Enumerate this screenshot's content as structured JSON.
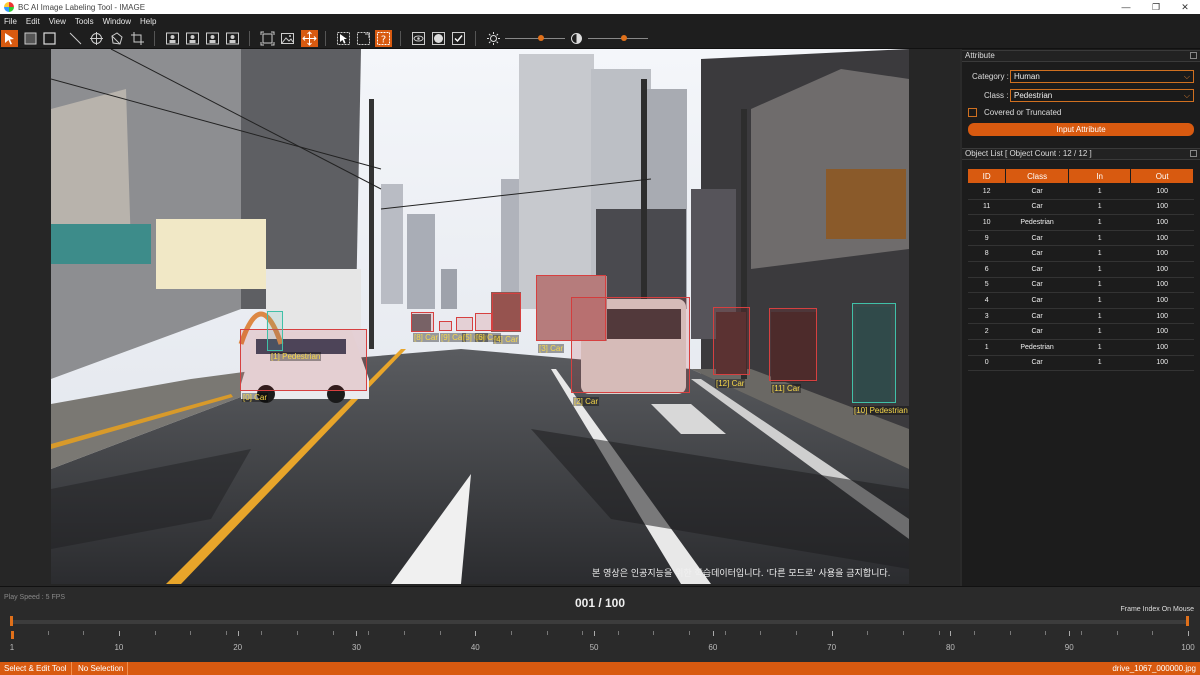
{
  "window": {
    "title": "BC AI Image Labeling Tool - IMAGE",
    "controls": {
      "minimize": "—",
      "restore": "❐",
      "close": "✕"
    }
  },
  "menu": [
    "File",
    "Edit",
    "View",
    "Tools",
    "Window",
    "Help"
  ],
  "toolbar": {
    "icons": [
      "select-arrow-icon",
      "rectangle-icon",
      "square-icon",
      "line-icon",
      "crosshair-icon",
      "polygon-icon",
      "crop-icon",
      "person-box-1-icon",
      "person-box-2-icon",
      "person-box-3-icon",
      "person-box-4-icon",
      "fit-icon",
      "image-icon",
      "move-icon",
      "pointer-box-icon",
      "lasso-icon",
      "help-icon",
      "eye-icon",
      "circle-icon",
      "check-icon",
      "brightness-icon",
      "contrast-icon"
    ],
    "brightness_level": 0.6,
    "contrast_level": 0.6
  },
  "scene": {
    "watermark": "본 영상은 인공지능을 위한 학습데이터입니다. '다른 모드로' 사용을 금지합니다."
  },
  "annotations": [
    {
      "label": "[0] Car",
      "type": "vehicle"
    },
    {
      "label": "[1] Pedestrian",
      "type": "human"
    },
    {
      "label": "[2] Car",
      "type": "vehicle"
    },
    {
      "label": "[3] Car",
      "type": "vehicle"
    },
    {
      "label": "[8] Car",
      "type": "vehicle"
    },
    {
      "label": "[9] Car",
      "type": "vehicle"
    },
    {
      "label": "[5] Car",
      "type": "vehicle"
    },
    {
      "label": "[6] Car",
      "type": "vehicle"
    },
    {
      "label": "[4] Car",
      "type": "vehicle"
    },
    {
      "label": "[10] Pedestrian",
      "type": "human"
    },
    {
      "label": "[11] Car",
      "type": "vehicle"
    },
    {
      "label": "[12] Car",
      "type": "vehicle"
    }
  ],
  "attribute_panel": {
    "title": "Attribute",
    "category_label": "Category :",
    "category_value": "Human",
    "class_label": "Class :",
    "class_value": "Pedestrian",
    "covered_label": "Covered or Truncated",
    "covered_checked": false,
    "input_button": "Input Attribute"
  },
  "object_list": {
    "title": "Object List  [ Object Count : 12 / 12 ]",
    "columns": [
      "ID",
      "Class",
      "In",
      "Out"
    ],
    "rows": [
      [
        "12",
        "Car",
        "1",
        "100"
      ],
      [
        "11",
        "Car",
        "1",
        "100"
      ],
      [
        "10",
        "Pedestrian",
        "1",
        "100"
      ],
      [
        "9",
        "Car",
        "1",
        "100"
      ],
      [
        "8",
        "Car",
        "1",
        "100"
      ],
      [
        "6",
        "Car",
        "1",
        "100"
      ],
      [
        "5",
        "Car",
        "1",
        "100"
      ],
      [
        "4",
        "Car",
        "1",
        "100"
      ],
      [
        "3",
        "Car",
        "1",
        "100"
      ],
      [
        "2",
        "Car",
        "1",
        "100"
      ],
      [
        "1",
        "Pedestrian",
        "1",
        "100"
      ],
      [
        "0",
        "Car",
        "1",
        "100"
      ]
    ]
  },
  "timeline": {
    "play_speed": "Play Speed : 5 FPS",
    "frame_counter": "001 / 100",
    "frame_mode": "Frame Index On Mouse",
    "current_frame": 1,
    "total_frames": 100,
    "tick_labels": [
      "1",
      "10",
      "20",
      "30",
      "40",
      "50",
      "60",
      "70",
      "80",
      "90",
      "100"
    ]
  },
  "statusbar": {
    "tool": "Select & Edit Tool",
    "selection": "No Selection",
    "filename": "drive_1067_000000.jpg"
  },
  "colors": {
    "accent": "#d85a10",
    "vehicle_box": "#d64040",
    "human_box": "#40c0a8",
    "label_text": "#f7d84a"
  }
}
